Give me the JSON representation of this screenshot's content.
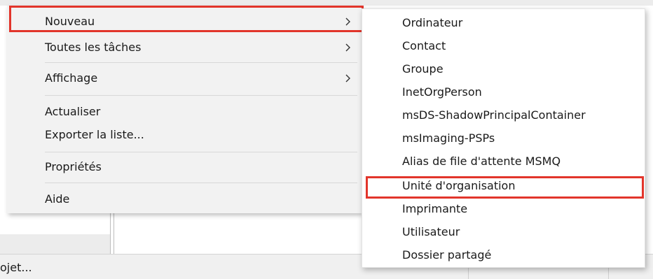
{
  "context_menu": {
    "items": [
      {
        "label": "Nouveau",
        "has_submenu": true
      },
      {
        "label": "Toutes les tâches",
        "has_submenu": true
      },
      {
        "label": "Affichage",
        "has_submenu": true
      },
      {
        "label": "Actualiser",
        "has_submenu": false
      },
      {
        "label": "Exporter la liste...",
        "has_submenu": false
      },
      {
        "label": "Propriétés",
        "has_submenu": false
      },
      {
        "label": "Aide",
        "has_submenu": false
      }
    ],
    "highlighted_item": "Nouveau"
  },
  "submenu": {
    "items": [
      "Ordinateur",
      "Contact",
      "Groupe",
      "InetOrgPerson",
      "msDS-ShadowPrincipalContainer",
      "msImaging-PSPs",
      "Alias de file d'attente MSMQ",
      "Unité d'organisation",
      "Imprimante",
      "Utilisateur",
      "Dossier partagé"
    ],
    "highlighted_item": "Unité d'organisation"
  },
  "status_bar": {
    "text": "ojet..."
  },
  "colors": {
    "menu_background": "#f2f2f2",
    "submenu_background": "#ffffff",
    "highlight_border": "#e2352b",
    "text": "#1a1a1a"
  },
  "icons": {
    "submenu_arrow": "chevron-right-icon"
  }
}
